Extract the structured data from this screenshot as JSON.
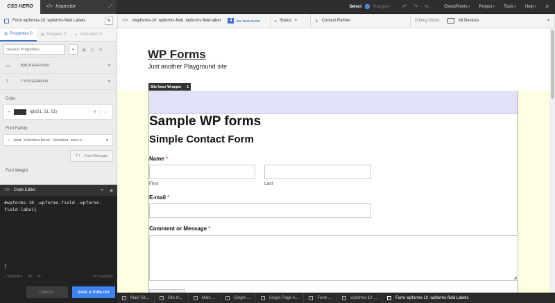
{
  "topbar": {
    "logo": "CSS HERO",
    "inspector_tab": "Inspector",
    "mode_select": "Select",
    "mode_navigate": "Navigate",
    "menu": [
      "CheckPoints",
      "Project",
      "Tools",
      "Help"
    ]
  },
  "selector_bar": {
    "target": "Form wpforms-10 .wpforms-field Labels",
    "selector": "#wpforms-10 .wpforms-field .wpforms-field-label",
    "count": "4",
    "on_page": "ON THIS PAGE",
    "status": "Status",
    "context_refiner": "Context Refiner",
    "editing_mode_label": "Editing Mode:",
    "device": "All Devices"
  },
  "left_panel": {
    "tabs": [
      {
        "label": "Properties",
        "count": "0"
      },
      {
        "label": "Snippets",
        "count": "0"
      },
      {
        "label": "Animation",
        "count": "0"
      }
    ],
    "search_placeholder": "Search Properties",
    "sections": [
      "BACKGROUND",
      "TYPOGRAPHY"
    ],
    "color_label": "Color",
    "color_value": "rgb(51, 51, 51)",
    "font_family_label": "Font Family",
    "font_family_value": "Arial, 'Helvetica Neue', Helvetica, sans-s...",
    "font_manager": "Font Manager",
    "font_weight_label": "Font Weight"
  },
  "code_editor": {
    "title": "Code Editor",
    "code": "#wpforms-10 .wpforms-field .wpforms-field-label{",
    "closing": "}",
    "tool_maximize": "Maximize",
    "tool_a_plus": "A+",
    "tool_a_minus": "A-",
    "tool_inspector": "Inspector",
    "cancel": "CANCEL",
    "save_publish": "SAVE & PUBLISH"
  },
  "preview": {
    "site_title": "WP Forms",
    "site_tagline": "Just another Playground site",
    "wrapper_label": "Site Inner Wrapper",
    "wrapper_count": "1",
    "heading": "Sample WP forms",
    "form_title": "Simple Contact Form",
    "name_label": "Name",
    "first_label": "First",
    "last_label": "Last",
    "email_label": "E-mail",
    "comment_label": "Comment or Message",
    "required_mark": "*"
  },
  "breadcrumbs": [
    "Main Sit...",
    "Site In...",
    "Main ...",
    "Single ...",
    "Single Page A...",
    "Form ...",
    "wpforms-10 ...",
    "Form wpforms-10 .wpforms-field Labels"
  ],
  "colors": {
    "accent": "#3b82f6",
    "swatch": "#333333",
    "required": "#cc0000"
  }
}
